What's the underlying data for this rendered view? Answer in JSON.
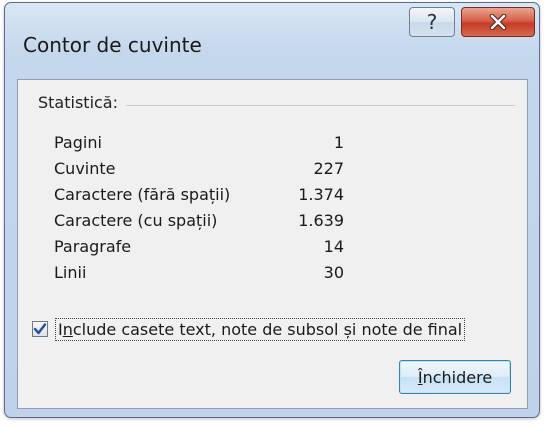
{
  "window": {
    "title": "Contor de cuvinte",
    "help_glyph": "?",
    "close_glyph": "✕"
  },
  "stats": {
    "heading": "Statistică:",
    "rows": [
      {
        "label": "Pagini",
        "value": "1"
      },
      {
        "label": "Cuvinte",
        "value": "227"
      },
      {
        "label": "Caractere (fără spații)",
        "value": "1.374"
      },
      {
        "label": "Caractere (cu spații)",
        "value": "1.639"
      },
      {
        "label": "Paragrafe",
        "value": "14"
      },
      {
        "label": "Linii",
        "value": "30"
      }
    ]
  },
  "checkbox": {
    "checked": true,
    "label_first": "I",
    "label_underlined": "n",
    "label_rest": "clude casete text, note de subsol și note de final"
  },
  "close_button": {
    "label_underlined": "Î",
    "label_rest": "nchidere"
  },
  "colors": {
    "check_mark": "#1f4fa0",
    "close_button_red": "#c43c27",
    "title_bar": "#c5d7ec"
  }
}
